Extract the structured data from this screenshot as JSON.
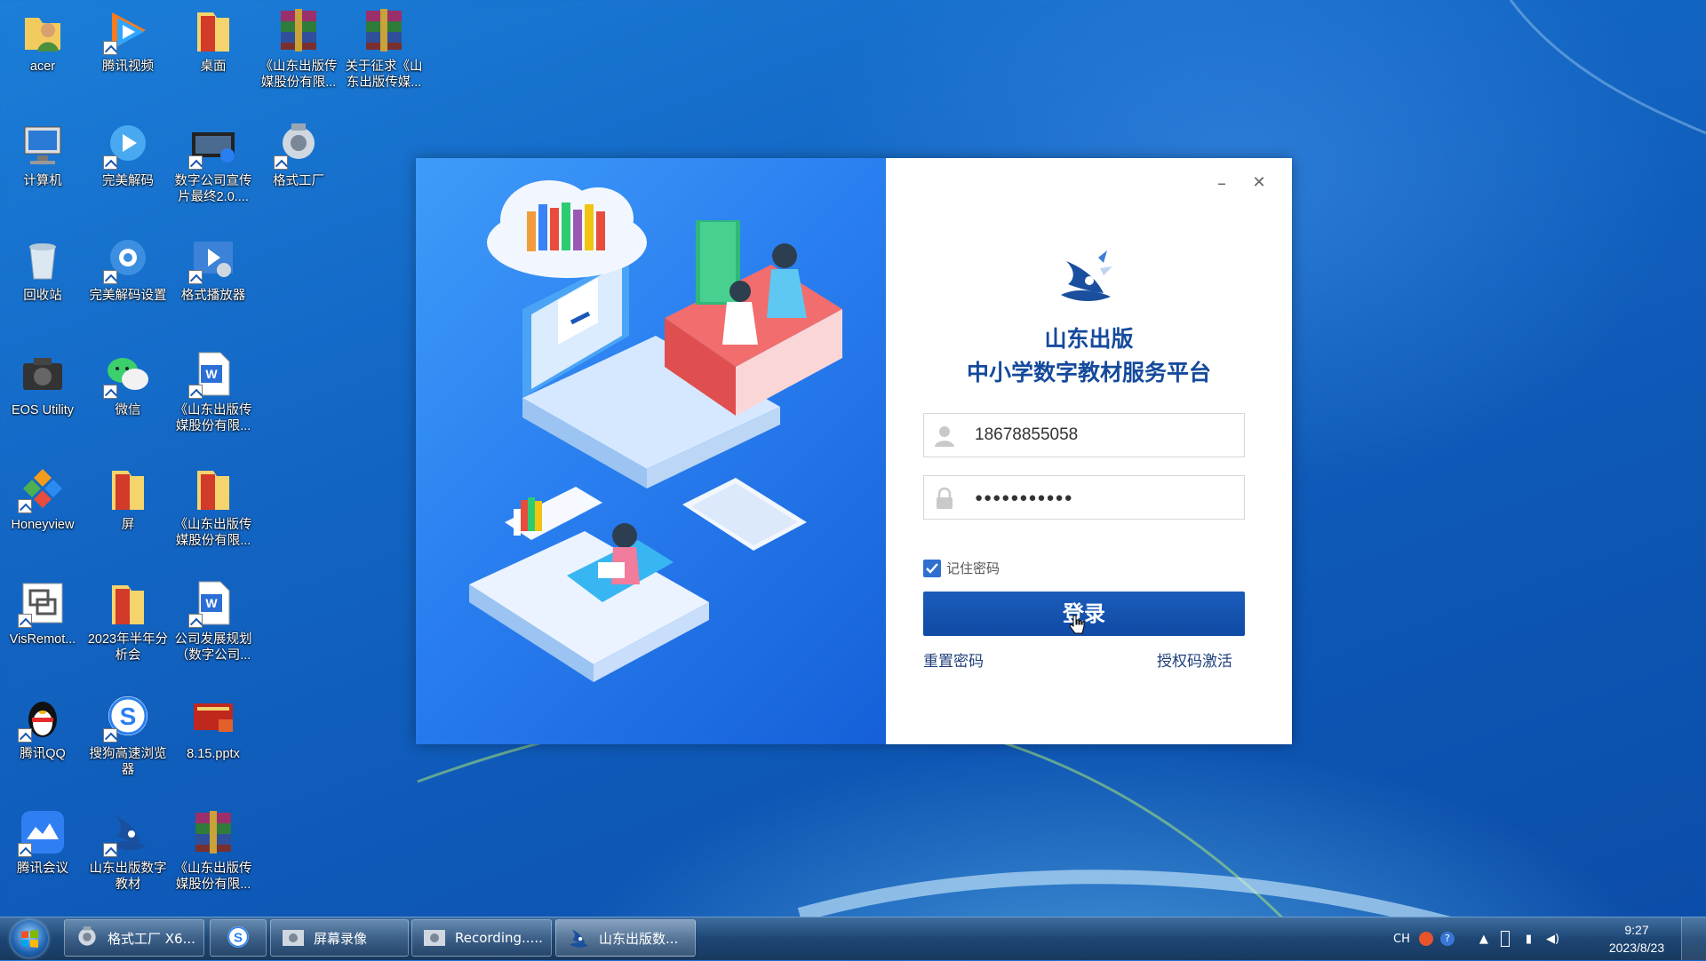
{
  "desktop": {
    "icons": [
      {
        "label": "acer",
        "icon": "user-folder-icon"
      },
      {
        "label": "腾讯视频",
        "icon": "tencent-video-icon"
      },
      {
        "label": "桌面",
        "icon": "folder-icon"
      },
      {
        "label": "《山东出版传媒股份有限...",
        "icon": "winrar-archive-icon"
      },
      {
        "label": "关于征求《山东出版传媒...",
        "icon": "winrar-archive-icon"
      },
      {
        "label": "计算机",
        "icon": "computer-icon"
      },
      {
        "label": "完美解码",
        "icon": "potplayer-icon"
      },
      {
        "label": "数字公司宣传片最终2.0....",
        "icon": "video-file-icon"
      },
      {
        "label": "格式工厂",
        "icon": "format-factory-icon"
      },
      {
        "label": "回收站",
        "icon": "recycle-bin-icon"
      },
      {
        "label": "完美解码设置",
        "icon": "settings-gear-icon"
      },
      {
        "label": "格式播放器",
        "icon": "format-player-icon"
      },
      {
        "label": "EOS Utility",
        "icon": "camera-icon"
      },
      {
        "label": "微信",
        "icon": "wechat-icon"
      },
      {
        "label": "《山东出版传媒股份有限...",
        "icon": "word-document-icon"
      },
      {
        "label": "Honeyview",
        "icon": "honeyview-icon"
      },
      {
        "label": "屏",
        "icon": "folder-icon"
      },
      {
        "label": "《山东出版传媒股份有限...",
        "icon": "folder-icon"
      },
      {
        "label": "VisRemot...",
        "icon": "remote-desktop-icon"
      },
      {
        "label": "2023年半年分析会",
        "icon": "folder-icon"
      },
      {
        "label": "公司发展规划（数字公司...",
        "icon": "word-document-icon"
      },
      {
        "label": "腾讯QQ",
        "icon": "qq-penguin-icon"
      },
      {
        "label": "搜狗高速浏览器",
        "icon": "sogou-browser-icon"
      },
      {
        "label": "8.15.pptx",
        "icon": "powerpoint-file-icon"
      },
      {
        "label": "腾讯会议",
        "icon": "tencent-meeting-icon"
      },
      {
        "label": "山东出版数字教材",
        "icon": "shandong-publishing-icon"
      },
      {
        "label": "《山东出版传媒股份有限...",
        "icon": "winrar-archive-icon"
      }
    ]
  },
  "login": {
    "brand_line1": "山东出版",
    "brand_line2": "中小学数字教材服务平台",
    "username_value": "18678855058",
    "password_value": "●●●●●●●●●●●",
    "remember_label": "记住密码",
    "remember_checked": true,
    "login_button": "登录",
    "reset_password_link": "重置密码",
    "activate_link": "授权码激活",
    "minimize_symbol": "–",
    "close_symbol": "✕"
  },
  "taskbar": {
    "items": [
      {
        "label": "格式工厂 X6...",
        "icon": "format-factory-icon"
      },
      {
        "label": "",
        "icon": "sogou-browser-icon"
      },
      {
        "label": "屏幕录像",
        "icon": "screen-recorder-icon"
      },
      {
        "label": "Recording.....",
        "icon": "recording-icon"
      },
      {
        "label": "山东出版数...",
        "icon": "shandong-publishing-icon"
      }
    ],
    "tray": {
      "lang": "CH",
      "time": "9:27",
      "date": "2023/8/23"
    }
  },
  "colors": {
    "brand_blue": "#154a9c",
    "button_blue": "#1452b0",
    "illustration_blue": "#2a7ff0",
    "desktop_blue": "#1366c4"
  }
}
